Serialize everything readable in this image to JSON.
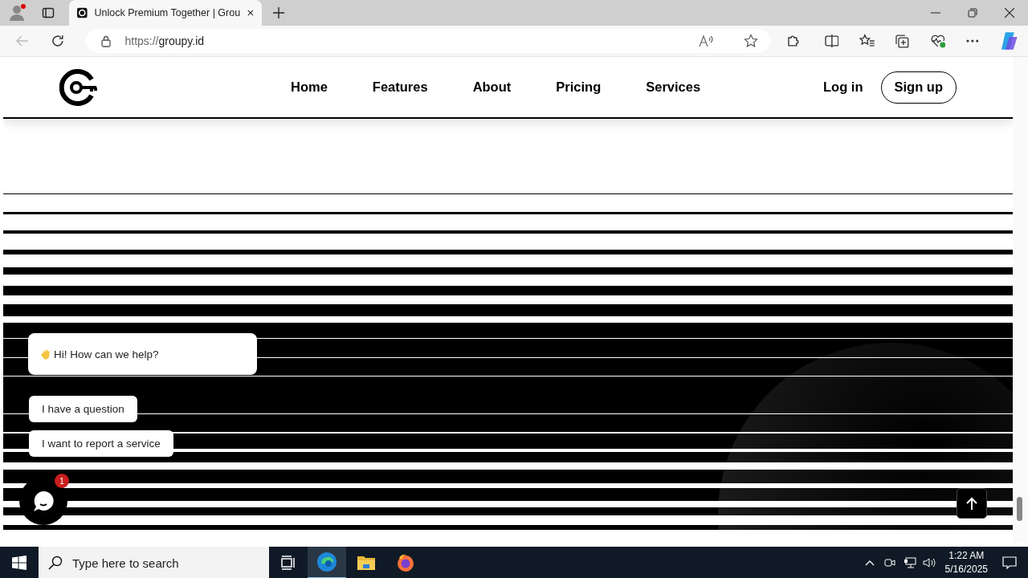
{
  "browser": {
    "tabs": [
      {
        "title": "Unlock Premium Together | Grou",
        "selected": true
      }
    ],
    "address": {
      "scheme": "https://",
      "host": "groupy.id"
    }
  },
  "site": {
    "nav": [
      {
        "label": "Home"
      },
      {
        "label": "Features"
      },
      {
        "label": "About"
      },
      {
        "label": "Pricing"
      },
      {
        "label": "Services"
      }
    ],
    "login": "Log in",
    "signup": "Sign up"
  },
  "chat": {
    "greeting": "Hi! How can we help?",
    "options": [
      "I have a question",
      "I want to report a service"
    ],
    "unread": "1"
  },
  "taskbar": {
    "search_placeholder": "Type here to search",
    "time": "1:22 AM",
    "date": "5/16/2025"
  }
}
